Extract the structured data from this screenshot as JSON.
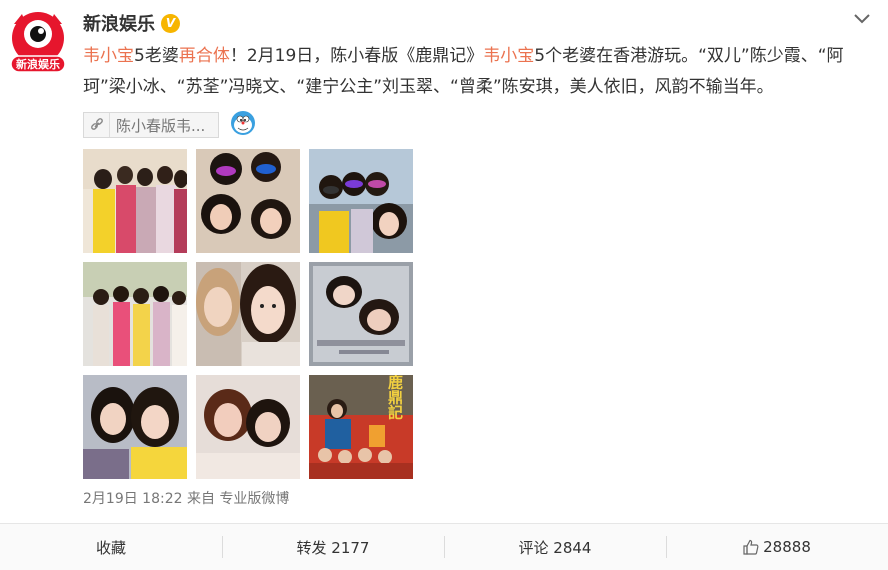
{
  "account": {
    "name": "新浪娱乐",
    "avatar_text": "新浪娱乐",
    "verified_icon": "verified-v-badge"
  },
  "post": {
    "topic_1": "韦小宝",
    "text_1": "5老婆",
    "topic_2": "再合体",
    "text_2": "！2月19日，陈小春版《鹿鼎记》",
    "topic_3": "韦小宝",
    "text_3": "5个老婆在香港游玩。“双儿”陈少霞、“阿珂”梁小冰、“苏荃”冯晓文、“建宁公主”刘玉翠、“曾柔”陈安琪，美人依旧，风韵不输当年。"
  },
  "chip": {
    "label": "陈小春版韦...",
    "icon": "link-icon"
  },
  "meta": {
    "time": "2月19日 18:22",
    "from": "来自",
    "source": "专业版微博"
  },
  "actions": [
    {
      "label": "收藏",
      "icon": ""
    },
    {
      "label": "转发 2177",
      "icon": ""
    },
    {
      "label": "评论 2844",
      "icon": ""
    },
    {
      "label": "28888",
      "icon": "thumbs-up-icon"
    }
  ],
  "poster_text": "鹿鼎記",
  "colors": {
    "accent": "#eb7350",
    "verified": "#f7b500",
    "brand": "#e6162d"
  }
}
